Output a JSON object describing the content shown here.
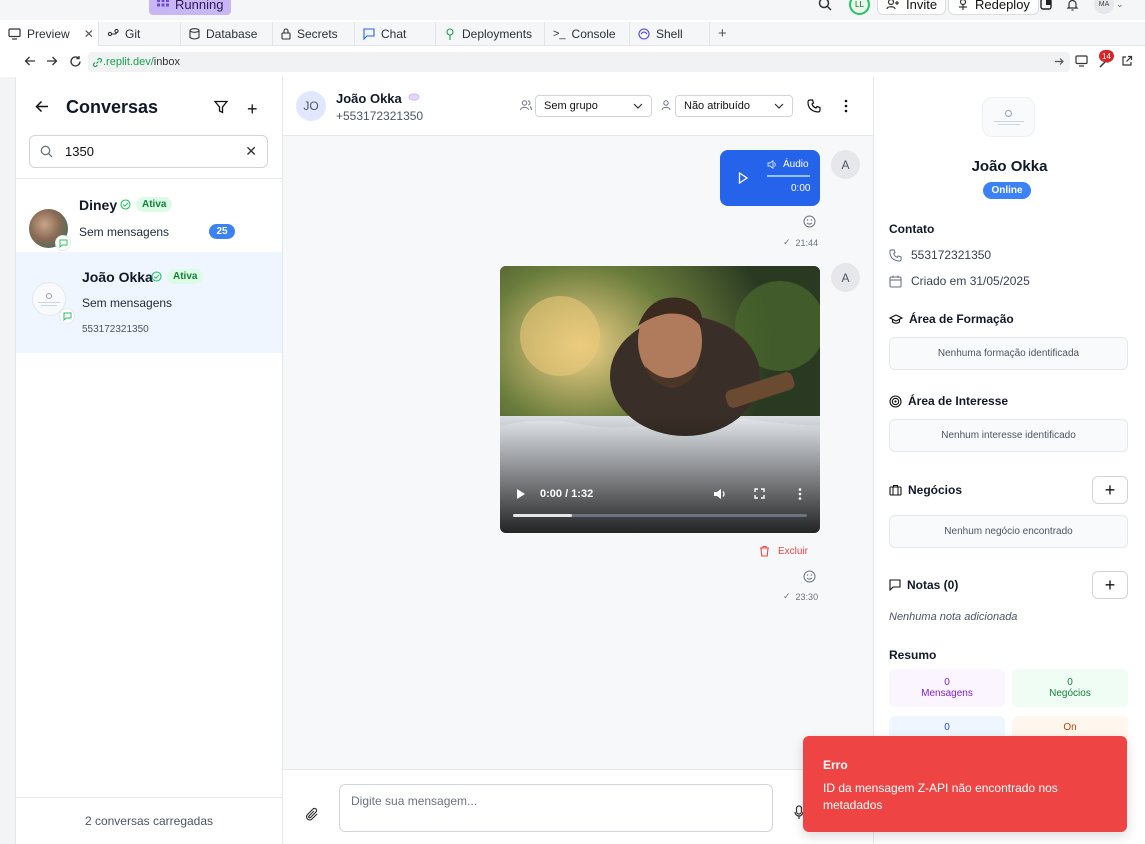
{
  "topbar": {
    "running_label": "Running",
    "invite_label": "Invite",
    "redeploy_label": "Redeploy",
    "user_initials": "LL",
    "avatar_initials": "MA",
    "notification_count": "14"
  },
  "tabs": [
    {
      "label": "Preview",
      "icon": "monitor-icon"
    },
    {
      "label": "Git",
      "icon": "git-icon"
    },
    {
      "label": "Database",
      "icon": "database-icon"
    },
    {
      "label": "Secrets",
      "icon": "lock-icon"
    },
    {
      "label": "Chat",
      "icon": "chat-icon"
    },
    {
      "label": "Deployments",
      "icon": "deploy-icon"
    },
    {
      "label": "Console",
      "icon": "terminal-icon"
    },
    {
      "label": "Shell",
      "icon": "shell-icon"
    }
  ],
  "address": {
    "url_prefix": ".replit.dev/",
    "url_path": "inbox"
  },
  "left": {
    "title": "Conversas",
    "search_value": "1350",
    "conversations": [
      {
        "name": "Diney",
        "status": "Ativa",
        "message": "Sem mensagens",
        "unread": "25"
      },
      {
        "name": "João Okka",
        "status": "Ativa",
        "message": "Sem mensagens",
        "phone": "553172321350"
      }
    ],
    "footer": "2 conversas carregadas"
  },
  "chat": {
    "avatar_initials": "JO",
    "contact_name": "João Okka",
    "contact_phone": "+553172321350",
    "group_select": "Sem grupo",
    "assign_select": "Não atribuído",
    "audio": {
      "label": "Áudio",
      "duration": "0:00",
      "time": "21:44"
    },
    "video": {
      "time_display": "0:00 / 1:32",
      "delete_label": "Excluir",
      "time": "23:30",
      "progress": 0.2
    },
    "sender_initial": "A",
    "input_placeholder": "Digite sua mensagem..."
  },
  "right": {
    "name": "João Okka",
    "online_label": "Online",
    "contact_title": "Contato",
    "phone": "553172321350",
    "created": "Criado em 31/05/2025",
    "formacao_title": "Área de Formação",
    "formacao_empty": "Nenhuma formação identificada",
    "interesse_title": "Área de Interesse",
    "interesse_empty": "Nenhum interesse identificado",
    "negocios_title": "Negócios",
    "negocios_empty": "Nenhum negócio encontrado",
    "notas_title": "Notas (0)",
    "notas_empty": "Nenhuma nota adicionada",
    "resumo_title": "Resumo",
    "stats": [
      {
        "value": "0",
        "label": "Mensagens",
        "color": "#7e22ce",
        "bg": "#faf5ff"
      },
      {
        "value": "0",
        "label": "Negócios",
        "color": "#15803d",
        "bg": "#f0fdf4"
      },
      {
        "value": "0",
        "label": "",
        "color": "#1d4ed8",
        "bg": "#eff6ff"
      },
      {
        "value": "On",
        "label": "",
        "color": "#c2410c",
        "bg": "#fff7ed"
      }
    ]
  },
  "toast": {
    "title": "Erro",
    "message": "ID da mensagem Z-API não encontrado nos metadados"
  },
  "colors": {
    "primary": "#2563eb",
    "error": "#ef4444",
    "success": "#22c55e",
    "badge_blue": "#3b82f6"
  }
}
